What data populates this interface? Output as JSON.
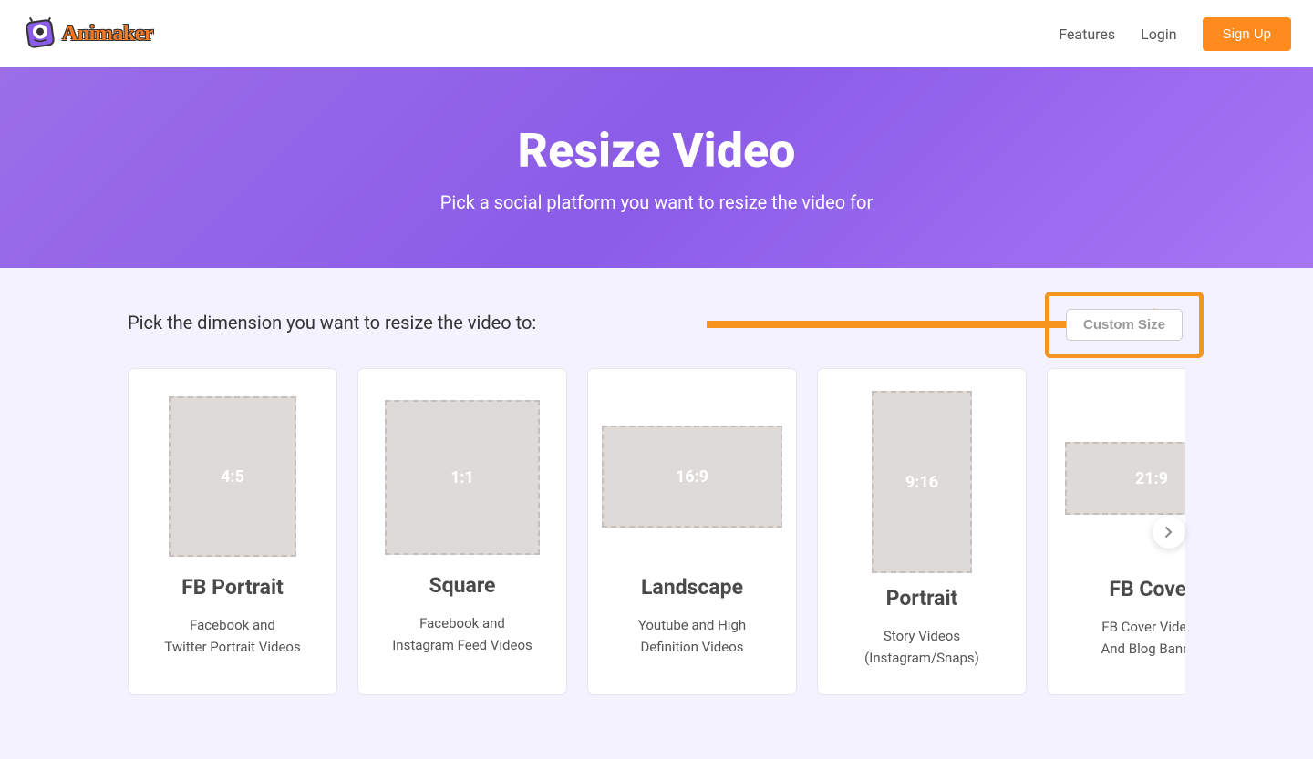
{
  "nav": {
    "brand": "Animaker",
    "features": "Features",
    "login": "Login",
    "signup": "Sign Up"
  },
  "hero": {
    "title": "Resize Video",
    "subtitle": "Pick a social platform you want to resize the video for"
  },
  "main": {
    "label": "Pick the dimension you want to resize the video to:",
    "custom": "Custom Size"
  },
  "cards": [
    {
      "ratio": "4:5",
      "title": "FB Portrait",
      "desc1": "Facebook and",
      "desc2": "Twitter Portrait Videos"
    },
    {
      "ratio": "1:1",
      "title": "Square",
      "desc1": "Facebook and",
      "desc2": "Instagram Feed Videos"
    },
    {
      "ratio": "16:9",
      "title": "Landscape",
      "desc1": "Youtube and High",
      "desc2": "Definition Videos"
    },
    {
      "ratio": "9:16",
      "title": "Portrait",
      "desc1": "Story Videos",
      "desc2": "(Instagram/Snaps)"
    },
    {
      "ratio": "21:9",
      "title": "FB Cover",
      "desc1": "FB Cover Videos",
      "desc2": "And Blog Banner"
    }
  ]
}
